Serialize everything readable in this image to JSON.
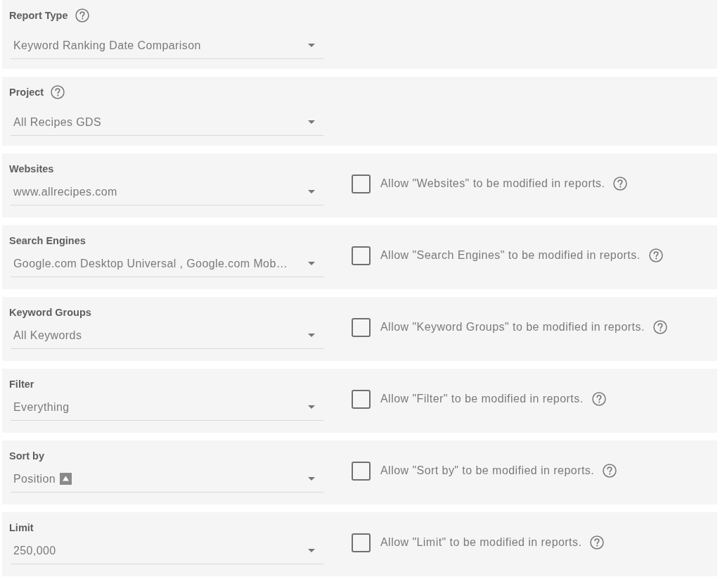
{
  "fields": [
    {
      "label": "Report Type",
      "label_help": true,
      "value": "Keyword Ranking Date Comparison"
    },
    {
      "label": "Project",
      "label_help": true,
      "value": "All Recipes GDS"
    },
    {
      "label": "Websites",
      "label_help": false,
      "value": "www.allrecipes.com",
      "allow": {
        "text": "Allow \"Websites\" to be modified in reports.",
        "checked": false
      }
    },
    {
      "label": "Search Engines",
      "label_help": false,
      "value": "Google.com Desktop Universal , Google.com Mob…",
      "allow": {
        "text": "Allow \"Search Engines\" to be modified in reports.",
        "checked": false
      }
    },
    {
      "label": "Keyword Groups",
      "label_help": false,
      "value": "All Keywords",
      "allow": {
        "text": "Allow \"Keyword Groups\" to be modified in reports.",
        "checked": false
      }
    },
    {
      "label": "Filter",
      "label_help": false,
      "value": "Everything",
      "allow": {
        "text": "Allow \"Filter\" to be modified in reports.",
        "checked": false
      }
    },
    {
      "label": "Sort by",
      "label_help": false,
      "value": "Position",
      "sort_ascending": true,
      "allow": {
        "text": "Allow \"Sort by\" to be modified in reports.",
        "checked": false
      }
    },
    {
      "label": "Limit",
      "label_help": false,
      "value": "250,000",
      "allow": {
        "text": "Allow \"Limit\" to be modified in reports.",
        "checked": false
      }
    }
  ]
}
